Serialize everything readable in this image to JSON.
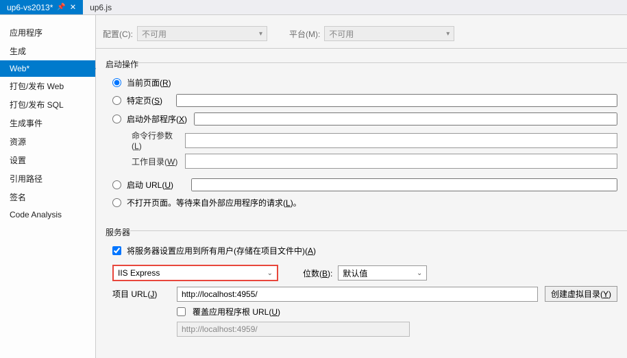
{
  "tabs": {
    "active": "up6-vs2013*",
    "inactive": "up6.js"
  },
  "sidebar": {
    "items": [
      "应用程序",
      "生成",
      "Web*",
      "打包/发布 Web",
      "打包/发布 SQL",
      "生成事件",
      "资源",
      "设置",
      "引用路径",
      "签名",
      "Code Analysis"
    ],
    "selectedIndex": 2
  },
  "topbar": {
    "config_label": "配置(C):",
    "config_value": "不可用",
    "platform_label": "平台(M):",
    "platform_value": "不可用"
  },
  "start": {
    "title": "启动操作",
    "current_page": "当前页面(R)",
    "specific_page": "特定页(S)",
    "external_program": "启动外部程序(X)",
    "cmd_args": "命令行参数(L)",
    "workdir": "工作目录(W)",
    "start_url": "启动 URL(U)",
    "no_open": "不打开页面。等待来自外部应用程序的请求(L)。",
    "selected": "current"
  },
  "server": {
    "title": "服务器",
    "apply_all": "将服务器设置应用到所有用户(存储在项目文件中)(A)",
    "apply_all_checked": true,
    "server_value": "IIS Express",
    "bits_label": "位数(B):",
    "bits_value": "默认值",
    "project_url_label": "项目 URL(J)",
    "project_url_value": "http://localhost:4955/",
    "create_vdir": "创建虚拟目录(Y)",
    "override_root": "覆盖应用程序根 URL(U)",
    "override_root_checked": false,
    "override_url_value": "http://localhost:4959/"
  }
}
